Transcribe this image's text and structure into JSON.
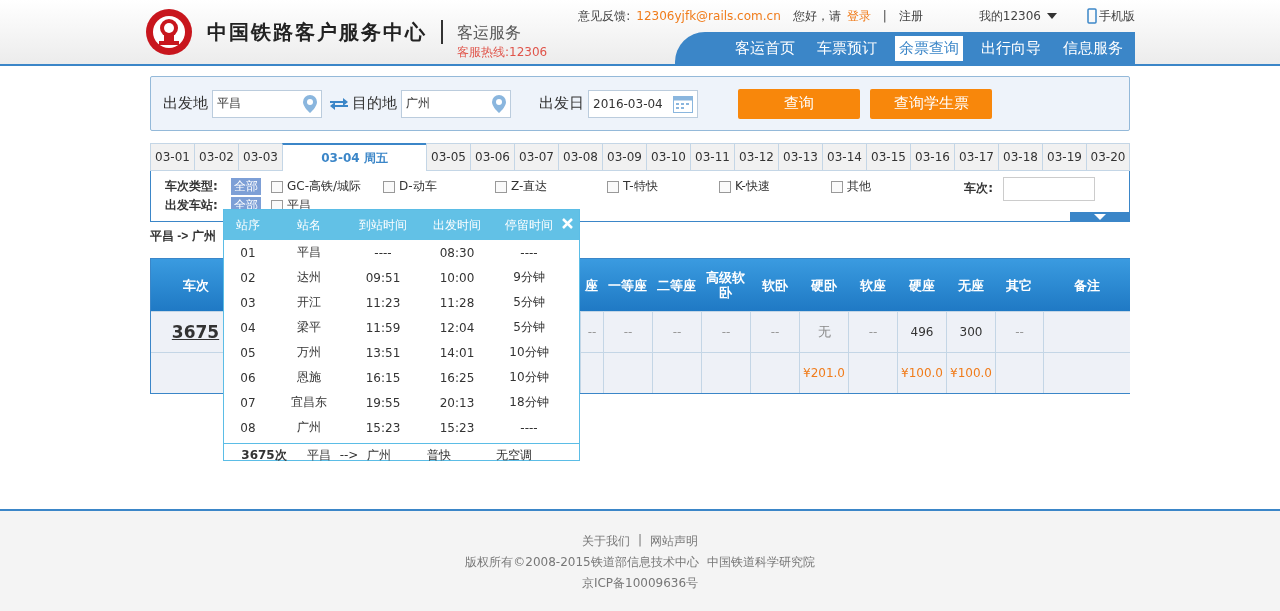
{
  "header": {
    "site_title": "中国铁路客户服务中心",
    "subtitle": "客运服务",
    "hotline": "客服热线:12306",
    "feedback_label": "意见反馈:",
    "feedback_email": "12306yjfk@rails.com.cn",
    "greeting": "您好，请",
    "login": "登录",
    "separator": "|",
    "register": "注册",
    "my12306": "我的12306",
    "mobile": "手机版"
  },
  "nav": [
    {
      "label": "客运首页",
      "selected": false
    },
    {
      "label": "车票预订",
      "selected": false
    },
    {
      "label": "余票查询",
      "selected": true
    },
    {
      "label": "出行向导",
      "selected": false
    },
    {
      "label": "信息服务",
      "selected": false
    }
  ],
  "search": {
    "from_label": "出发地",
    "from_value": "平昌",
    "to_label": "目的地",
    "to_value": "广州",
    "date_label": "出发日",
    "date_value": "2016-03-04",
    "buttons": [
      "查询",
      "查询学生票"
    ]
  },
  "date_tabs": [
    {
      "label": "03-01",
      "selected": false
    },
    {
      "label": "03-02",
      "selected": false
    },
    {
      "label": "03-03",
      "selected": false
    },
    {
      "label": "03-04 周五",
      "selected": true
    },
    {
      "label": "03-05",
      "selected": false
    },
    {
      "label": "03-06",
      "selected": false
    },
    {
      "label": "03-07",
      "selected": false
    },
    {
      "label": "03-08",
      "selected": false
    },
    {
      "label": "03-09",
      "selected": false
    },
    {
      "label": "03-10",
      "selected": false
    },
    {
      "label": "03-11",
      "selected": false
    },
    {
      "label": "03-12",
      "selected": false
    },
    {
      "label": "03-13",
      "selected": false
    },
    {
      "label": "03-14",
      "selected": false
    },
    {
      "label": "03-15",
      "selected": false
    },
    {
      "label": "03-16",
      "selected": false
    },
    {
      "label": "03-17",
      "selected": false
    },
    {
      "label": "03-18",
      "selected": false
    },
    {
      "label": "03-19",
      "selected": false
    },
    {
      "label": "03-20",
      "selected": false
    }
  ],
  "filters": {
    "type_label": "车次类型:",
    "type_all": "全部",
    "types": [
      {
        "label": "GC-高铁/城际",
        "checked": false
      },
      {
        "label": "D-动车",
        "checked": false
      },
      {
        "label": "Z-直达",
        "checked": false
      },
      {
        "label": "T-特快",
        "checked": false
      },
      {
        "label": "K-快速",
        "checked": false
      },
      {
        "label": "其他",
        "checked": false
      }
    ],
    "train_no_label": "车次:",
    "station_label": "出发车站:",
    "station_all": "全部",
    "stations": [
      {
        "label": "平昌",
        "checked": false
      }
    ]
  },
  "route": "平昌 -> 广州",
  "table": {
    "columns": [
      "车次",
      "座",
      "一等座",
      "二等座",
      "高级软卧",
      "软卧",
      "硬卧",
      "软座",
      "硬座",
      "无座",
      "其它",
      "备注"
    ],
    "rows": [
      {
        "cells": [
          {
            "text": "3675",
            "kind": "train"
          },
          {
            "text": "--",
            "kind": "dash"
          },
          {
            "text": "--",
            "kind": "dash"
          },
          {
            "text": "--",
            "kind": "dash"
          },
          {
            "text": "--",
            "kind": "dash"
          },
          {
            "text": "--",
            "kind": "dash"
          },
          {
            "text": "无",
            "kind": "none"
          },
          {
            "text": "--",
            "kind": "dash"
          },
          {
            "text": "496",
            "kind": "count"
          },
          {
            "text": "300",
            "kind": "count"
          },
          {
            "text": "--",
            "kind": "dash"
          },
          {
            "kind": "empty"
          }
        ],
        "prices": [
          {
            "kind": "empty"
          },
          {
            "kind": "empty"
          },
          {
            "kind": "empty"
          },
          {
            "kind": "empty"
          },
          {
            "kind": "empty"
          },
          {
            "kind": "empty"
          },
          {
            "text": "¥201.0",
            "kind": "price"
          },
          {
            "kind": "empty"
          },
          {
            "text": "¥100.0",
            "kind": "price"
          },
          {
            "text": "¥100.0",
            "kind": "price"
          },
          {
            "kind": "empty"
          },
          {
            "kind": "empty"
          }
        ]
      }
    ]
  },
  "popup": {
    "columns": [
      "站序",
      "站名",
      "到站时间",
      "出发时间",
      "停留时间"
    ],
    "stops": [
      {
        "no": "01",
        "name": "平昌",
        "arrive": "----",
        "depart": "08:30",
        "stay": "----"
      },
      {
        "no": "02",
        "name": "达州",
        "arrive": "09:51",
        "depart": "10:00",
        "stay": "9分钟"
      },
      {
        "no": "03",
        "name": "开江",
        "arrive": "11:23",
        "depart": "11:28",
        "stay": "5分钟"
      },
      {
        "no": "04",
        "name": "梁平",
        "arrive": "11:59",
        "depart": "12:04",
        "stay": "5分钟"
      },
      {
        "no": "05",
        "name": "万州",
        "arrive": "13:51",
        "depart": "14:01",
        "stay": "10分钟"
      },
      {
        "no": "06",
        "name": "恩施",
        "arrive": "16:15",
        "depart": "16:25",
        "stay": "10分钟"
      },
      {
        "no": "07",
        "name": "宜昌东",
        "arrive": "19:55",
        "depart": "20:13",
        "stay": "18分钟"
      },
      {
        "no": "08",
        "name": "广州",
        "arrive": "15:23",
        "depart": "15:23",
        "stay": "----"
      }
    ],
    "footer": {
      "train": "3675次",
      "from": "平昌",
      "arrow": "-->",
      "to": "广州",
      "type": "普快",
      "ac": "无空调"
    }
  },
  "footer": {
    "links": [
      "关于我们",
      "网站声明"
    ],
    "link_separator": "|",
    "copyright": "版权所有©2008-2015铁道部信息技术中心",
    "institute": "中国铁道科学研究院",
    "icp": "京ICP备10009636号"
  }
}
